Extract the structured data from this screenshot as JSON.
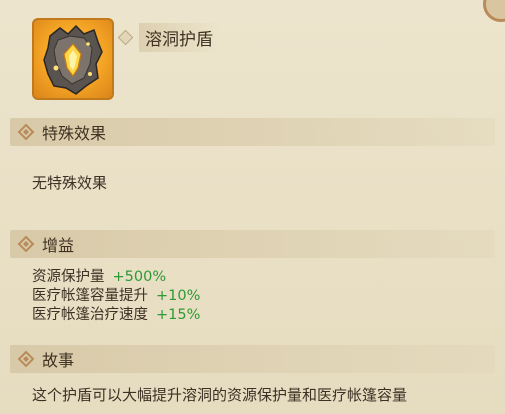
{
  "item": {
    "name": "溶洞护盾",
    "icon": "cave-shield-icon"
  },
  "sections": {
    "special": {
      "title": "特殊效果",
      "content": "无特殊效果"
    },
    "bonus": {
      "title": "增益",
      "items": [
        {
          "label": "资源保护量",
          "value": "+500%"
        },
        {
          "label": "医疗帐篷容量提升",
          "value": "+10%"
        },
        {
          "label": "医疗帐篷治疗速度",
          "value": "+15%"
        }
      ]
    },
    "story": {
      "title": "故事",
      "content": "这个护盾可以大幅提升溶洞的资源保护量和医疗帐篷容量"
    }
  },
  "colors": {
    "background": "#e9e0c7",
    "icon_frame": "#c07a1c",
    "bonus_value": "#2d9a34",
    "text": "#3d3024"
  }
}
